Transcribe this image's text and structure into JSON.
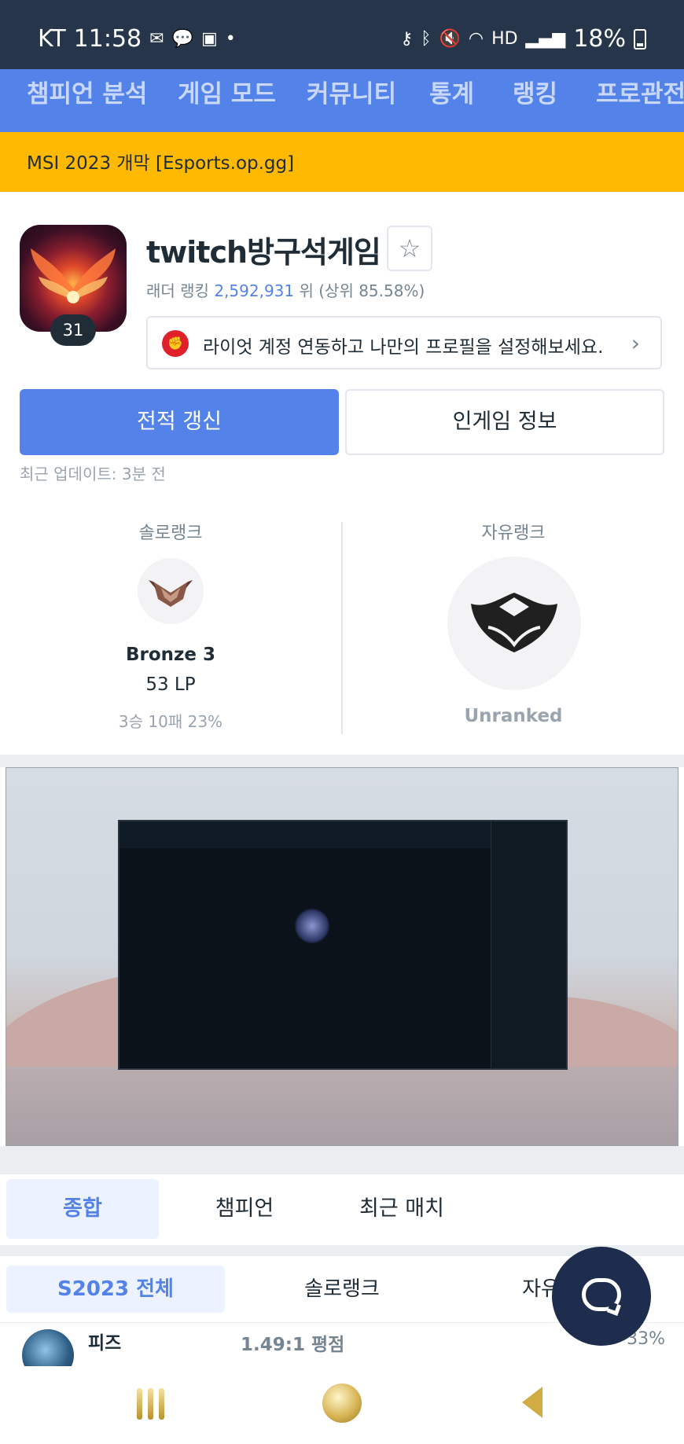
{
  "status_bar": {
    "carrier": "KT",
    "time": "11:58",
    "battery": "18%",
    "icons": [
      "mail-icon",
      "talk-icon",
      "chat-icon",
      "dot-icon",
      "key-icon",
      "bluetooth-icon",
      "mute-icon",
      "wifi-icon",
      "hd-icon",
      "signal-icon",
      "battery-icon"
    ]
  },
  "nav": {
    "items": [
      "챔피언 분석",
      "게임 모드",
      "커뮤니티",
      "통계",
      "랭킹",
      "프로관전"
    ]
  },
  "banner": {
    "text": "MSI 2023 개막 [Esports.op.gg]"
  },
  "profile": {
    "level": "31",
    "name": "twitch방구석게임",
    "ladder_prefix": "래더 랭킹 ",
    "ladder_rank": "2,592,931",
    "ladder_suffix": " 위 (상위 85.58%)",
    "riot_link_text": "라이엇 계정 연동하고 나만의 프로필을 설정해보세요.",
    "update_button": "전적 갱신",
    "ingame_button": "인게임 정보",
    "last_update": "최근 업데이트: 3분 전"
  },
  "ranks": {
    "solo": {
      "title": "솔로랭크",
      "tier": "Bronze 3",
      "lp": "53 LP",
      "record": "3승 10패 23%"
    },
    "flex": {
      "title": "자유랭크",
      "tier": "Unranked"
    }
  },
  "tabs": {
    "items": [
      "종합",
      "챔피언",
      "최근 매치"
    ],
    "active": 0
  },
  "subtabs": {
    "items": [
      "S2023 전체",
      "솔로랭크",
      "자유"
    ],
    "active": 0
  },
  "champion_row": {
    "name": "피즈",
    "kda": "1.49:1 평점",
    "winrate": "33%"
  },
  "colors": {
    "primary": "#5383e8",
    "banner": "#ffb900",
    "status_bar": "#26354a",
    "fab": "#1e2d4d"
  }
}
